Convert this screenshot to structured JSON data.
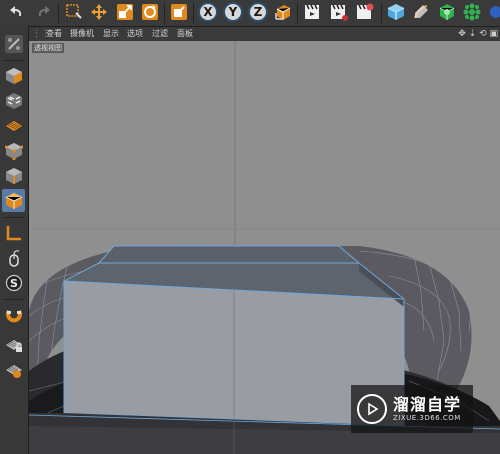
{
  "toolbar": {
    "buttons": [
      {
        "name": "undo-icon",
        "glyph": "↶"
      },
      {
        "name": "redo-icon",
        "glyph": "↷"
      },
      {
        "name": "select-icon",
        "glyph": "⬚"
      },
      {
        "name": "move-icon",
        "glyph": "✥"
      },
      {
        "name": "scale-icon",
        "glyph": "⤢"
      },
      {
        "name": "rotate-icon",
        "glyph": "⟳"
      },
      {
        "name": "recent-tool-icon",
        "glyph": "◪"
      }
    ],
    "axes": [
      "X",
      "Y",
      "Z"
    ]
  },
  "menubar": {
    "items": [
      "查看",
      "摄像机",
      "显示",
      "选项",
      "过滤",
      "面板"
    ]
  },
  "viewport": {
    "label": "透视视图"
  },
  "watermark": {
    "title": "溜溜自学",
    "url": "ZIXUE.3D66.COM"
  },
  "colors": {
    "accent": "#5a7ba8",
    "orange": "#e08a1e",
    "selection_edge": "#6fa8dc"
  }
}
